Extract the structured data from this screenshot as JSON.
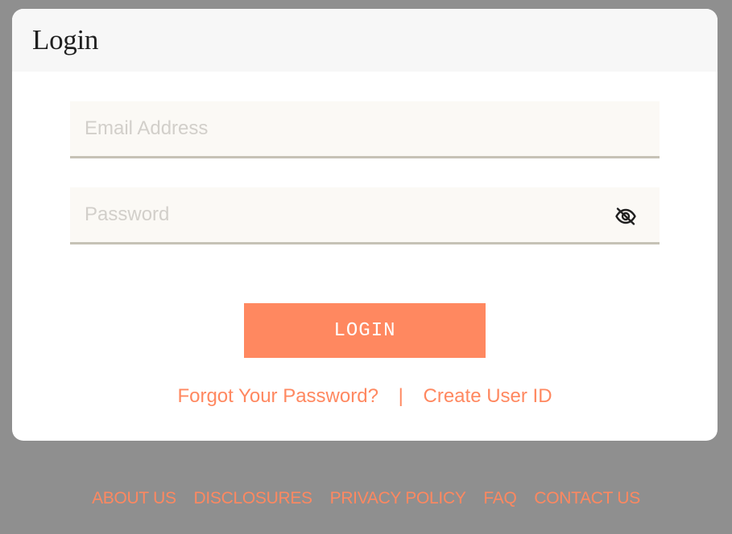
{
  "header": {
    "title": "Login"
  },
  "form": {
    "email": {
      "placeholder": "Email Address",
      "value": ""
    },
    "password": {
      "placeholder": "Password",
      "value": "",
      "toggle_icon": "eye-slash-icon"
    },
    "login_label": "LOGIN"
  },
  "links": {
    "forgot_password": "Forgot Your Password?",
    "separator": "|",
    "create_user_id": "Create User ID"
  },
  "footer": {
    "items": [
      {
        "label": "ABOUT US"
      },
      {
        "label": "DISCLOSURES"
      },
      {
        "label": "PRIVACY POLICY"
      },
      {
        "label": "FAQ"
      },
      {
        "label": "CONTACT US"
      }
    ]
  },
  "colors": {
    "accent": "#ff8860",
    "background": "#8f8f8f",
    "field_background": "#fbf9f5",
    "field_border": "#c6c2b6"
  }
}
